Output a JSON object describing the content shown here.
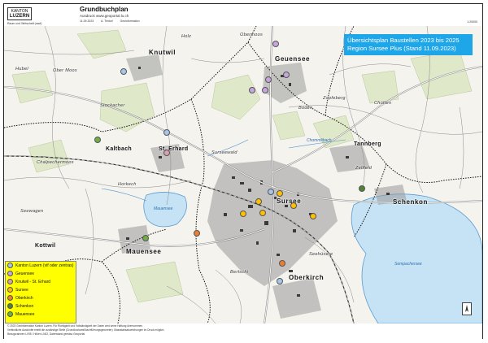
{
  "header": {
    "logo_top": "KANTON",
    "logo_name": "LUZERN",
    "org": "Raum und Wirtschaft (rawi)",
    "org2": "Geoinformation",
    "title": "Grundbuchplan",
    "subtitle": "Ausdruck www.geoportal.lu.ch",
    "date": "11.09.2023",
    "author": "A. Trinkel",
    "scale": "1:20000"
  },
  "title_box": {
    "line1": "Übersichtsplan Baustellen 2023 bis 2025",
    "line2": "Region Sursee Plus (Stand 11.09.2023)",
    "color": "#1fa6e8"
  },
  "places": {
    "knutwil": "Knutwil",
    "geuensee": "Geuensee",
    "kaltbach": "Kaltbach",
    "st_erhard": "St. Erhard",
    "sursee": "Sursee",
    "tannberg": "Tannberg",
    "schenkon": "Schenkon",
    "mauensee": "Mauensee",
    "kottwil": "Kottwil",
    "oberkirch": "Oberkirch",
    "hubel": "Hubel",
    "ober_moos": "Ober Moos",
    "stockacher": "Stockacher",
    "chalpechermoos": "Chalpechermoos",
    "horkech": "Horkech",
    "seewagen": "Seewagen",
    "obermoos": "Obermoos",
    "boden": "Boden",
    "zopfeberg": "Zopfeberg",
    "zellfeld": "Zellfeld",
    "surseewald": "Surseewald",
    "chotten": "Chotten",
    "bertschi": "Bertschi",
    "holz": "Holz",
    "seehusere": "Seehüsere"
  },
  "water": {
    "mauensee_lake": "Mauensee",
    "sempachersee": "Sempachersee",
    "chommlibach": "Chommlibach"
  },
  "legend": [
    {
      "label": "Kanton Luzern (vif oder zentras)",
      "color": "#a9c4ea"
    },
    {
      "label": "Geuensee",
      "color": "#c7a6e0"
    },
    {
      "label": "Knutwil - St. Erhard",
      "color": "#d9a0b0"
    },
    {
      "label": "Sursee",
      "color": "#ffc000"
    },
    {
      "label": "Oberkirch",
      "color": "#ed7d31"
    },
    {
      "label": "Schenkon",
      "color": "#548235"
    },
    {
      "label": "Mauensee",
      "color": "#70ad47"
    }
  ],
  "footer": {
    "line1": "© 2023 Geoinformation Kanton Luzern. Für Richtigkeit und Vollständigkeit der Daten wird keine Haftung übernommen.",
    "line2": "Verbindliche Auskünfte erteilt die zuständige Stelle (Grundbuchamt/Nachführungsgeometer). Massstabsabweichungen im Druck möglich.",
    "line3": "Bezugsrahmen LV95 / Höhen LN02, Datenstand gemäss Geoportal"
  }
}
